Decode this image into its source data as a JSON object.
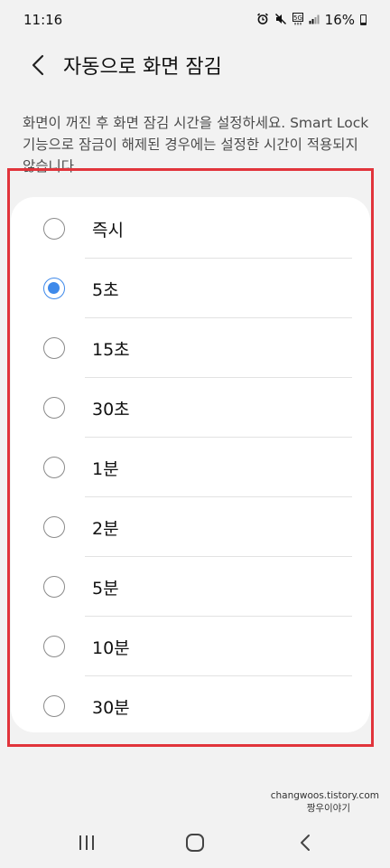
{
  "status_bar": {
    "time": "11:16",
    "battery_text": "16%",
    "icons": [
      "alarm-icon",
      "mute-icon",
      "5g-icon",
      "signal-icon",
      "battery-icon"
    ],
    "network_label": "5G"
  },
  "header": {
    "title": "자동으로 화면 잠김",
    "back_icon": "chevron-left-icon"
  },
  "description": "화면이 꺼진 후 화면 잠김 시간을 설정하세요. Smart Lock 기능으로 잠금이 해제된 경우에는 설정한 시간이 적용되지 않습니다.",
  "options": [
    {
      "label": "즉시",
      "selected": false
    },
    {
      "label": "5초",
      "selected": true
    },
    {
      "label": "15초",
      "selected": false
    },
    {
      "label": "30초",
      "selected": false
    },
    {
      "label": "1분",
      "selected": false
    },
    {
      "label": "2분",
      "selected": false
    },
    {
      "label": "5분",
      "selected": false
    },
    {
      "label": "10분",
      "selected": false
    },
    {
      "label": "30분",
      "selected": false
    }
  ],
  "watermark": {
    "site": "changwoos.tistory.com",
    "name": "짱우이야기"
  },
  "navbar": {
    "recents_icon": "recents-icon",
    "home_icon": "home-icon",
    "back_icon": "back-icon"
  },
  "colors": {
    "accent": "#3e89ea",
    "highlight_border": "#e1343b",
    "background": "#f2f2f2",
    "card": "#ffffff"
  }
}
